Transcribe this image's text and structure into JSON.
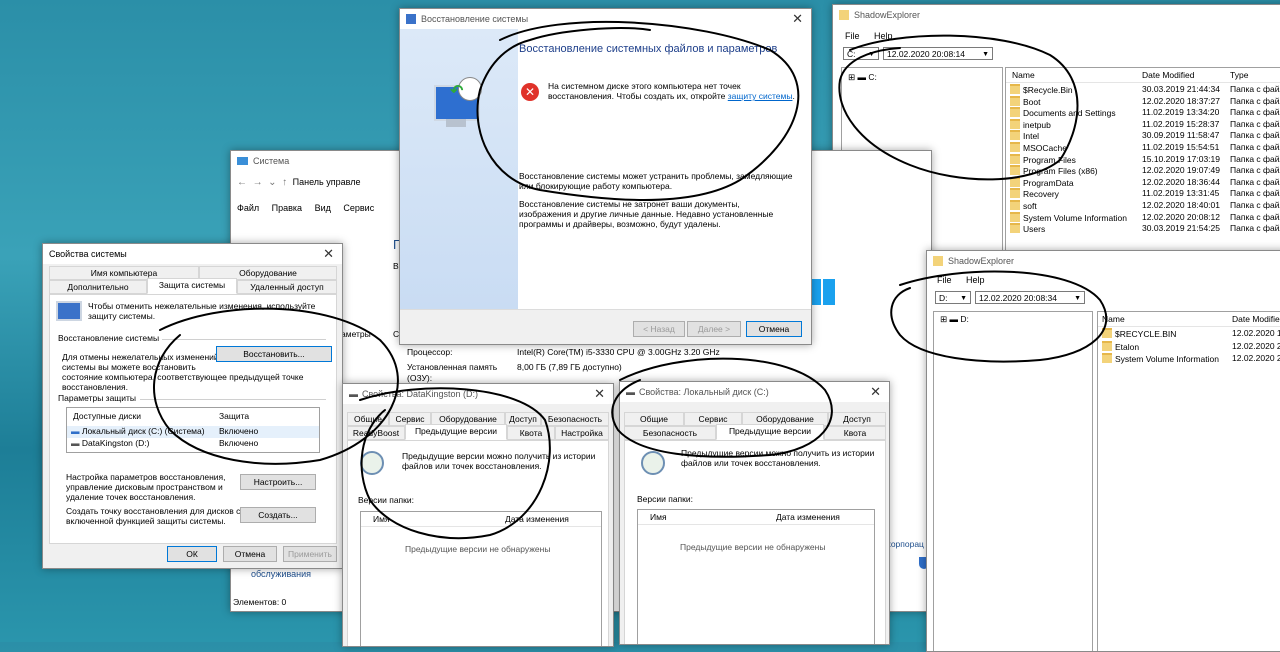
{
  "restore": {
    "title": "Восстановление системы",
    "heading": "Восстановление системных файлов и параметров",
    "error_text_1": "На системном диске этого компьютера нет точек",
    "error_text_2": "восстановления. Чтобы создать их, откройте",
    "error_link": "защиту системы",
    "error_tail": ".",
    "info1_1": "Восстановление системы может устранить проблемы, замедляющие",
    "info1_2": "или блокирующие работу компьютера.",
    "info2_1": "Восстановление системы не затронет ваши документы,",
    "info2_2": "изображения и другие личные данные. Недавно установленные",
    "info2_3": "программы и драйверы, возможно, будут удалены.",
    "back": "< Назад",
    "next": "Далее >",
    "cancel": "Отмена"
  },
  "shadow1": {
    "title": "ShadowExplorer",
    "menu": [
      "File",
      "Help"
    ],
    "drive": "C:",
    "date": "12.02.2020 20:08:14",
    "tree_root": "C:",
    "columns": [
      "Name",
      "Date Modified",
      "Type"
    ],
    "rows": [
      {
        "name": "$Recycle.Bin",
        "date": "30.03.2019 21:44:34",
        "type": "Папка с файл"
      },
      {
        "name": "Boot",
        "date": "12.02.2020 18:37:27",
        "type": "Папка с файл"
      },
      {
        "name": "Documents and Settings",
        "date": "11.02.2019 13:34:20",
        "type": "Папка с файл"
      },
      {
        "name": "inetpub",
        "date": "11.02.2019 15:28:37",
        "type": "Папка с файл"
      },
      {
        "name": "Intel",
        "date": "30.09.2019 11:58:47",
        "type": "Папка с файл"
      },
      {
        "name": "MSOCache",
        "date": "11.02.2019 15:54:51",
        "type": "Папка с файл"
      },
      {
        "name": "Program Files",
        "date": "15.10.2019 17:03:19",
        "type": "Папка с файл"
      },
      {
        "name": "Program Files (x86)",
        "date": "12.02.2020 19:07:49",
        "type": "Папка с файл"
      },
      {
        "name": "ProgramData",
        "date": "12.02.2020 18:36:44",
        "type": "Папка с файл"
      },
      {
        "name": "Recovery",
        "date": "11.02.2019 13:31:45",
        "type": "Папка с файл"
      },
      {
        "name": "soft",
        "date": "12.02.2020 18:40:01",
        "type": "Папка с файл"
      },
      {
        "name": "System Volume Information",
        "date": "12.02.2020 20:08:12",
        "type": "Папка с файл"
      },
      {
        "name": "Users",
        "date": "30.03.2019 21:54:25",
        "type": "Папка с файл"
      }
    ]
  },
  "shadow2": {
    "title": "ShadowExplorer",
    "menu": [
      "File",
      "Help"
    ],
    "drive": "D:",
    "date": "12.02.2020 20:08:34",
    "tree_root": "D:",
    "columns": [
      "Name",
      "Date Modified"
    ],
    "rows": [
      {
        "name": "$RECYCLE.BIN",
        "date": "12.02.2020 1"
      },
      {
        "name": "Etalon",
        "date": "12.02.2020 2"
      },
      {
        "name": "System Volume Information",
        "date": "12.02.2020 2"
      }
    ]
  },
  "system": {
    "title": "Система",
    "address": "Панель управле",
    "menu": [
      "Файл",
      "Правка",
      "Вид",
      "Сервис"
    ],
    "cpu_label": "Процессор:",
    "cpu_value": "Intel(R) Core(TM) i5-3330 CPU @ 3.00GHz   3.20 GHz",
    "ram_label": "Установленная память",
    "ram_label2": "(ОЗУ):",
    "ram_value": "8,00 ГБ (7,89 ГБ доступно)",
    "frag_p": "П",
    "frag_v": "Вы",
    "frag_metry": "аметры",
    "frag_s": "Сі",
    "frag_corp": "корпорац",
    "frag_maint": "обслуживания",
    "status": "Элементов: 0"
  },
  "sysprops": {
    "title": "Свойства системы",
    "tabs_top": [
      "Имя компьютера",
      "Оборудование"
    ],
    "tabs_bottom": [
      "Дополнительно",
      "Защита системы",
      "Удаленный доступ"
    ],
    "intro_1": "Чтобы отменить нежелательные изменения, используйте",
    "intro_2": "защиту системы.",
    "restore_group": "Восстановление системы",
    "restore_text_1": "Для отмены нежелательных изменений",
    "restore_text_2": "системы вы можете восстановить",
    "restore_text_3": "состояние компьютера, соответствующее предыдущей точке",
    "restore_text_4": "восстановления.",
    "restore_btn": "Восстановить...",
    "params_group": "Параметры защиты",
    "col_disks": "Доступные диски",
    "col_protect": "Защита",
    "disks": [
      {
        "name": "Локальный диск (C:) (Система)",
        "state": "Включено"
      },
      {
        "name": "DataKingston (D:)",
        "state": "Включено"
      }
    ],
    "config_text_1": "Настройка параметров восстановления,",
    "config_text_2": "управление дисковым пространством и",
    "config_text_3": "удаление точек восстановления.",
    "config_btn": "Настроить...",
    "create_text_1": "Создать точку восстановления для дисков с",
    "create_text_2": "включенной функцией защиты системы.",
    "create_btn": "Создать...",
    "ok": "ОК",
    "cancel": "Отмена",
    "apply": "Применить"
  },
  "propsD": {
    "title": "Свойства: DataKingston (D:)",
    "tabs_top": [
      "Общие",
      "Сервис",
      "Оборудование",
      "Доступ",
      "Безопасность"
    ],
    "tabs_bottom": [
      "ReadyBoost",
      "Предыдущие версии",
      "Квота",
      "Настройка"
    ],
    "info_1": "Предыдущие версии можно получить из истории",
    "info_2": "файлов или точек восстановления.",
    "versions_label": "Версии папки:",
    "col_name": "Имя",
    "col_date": "Дата изменения",
    "empty": "Предыдущие версии не обнаружены"
  },
  "propsC": {
    "title": "Свойства: Локальный диск (C:)",
    "tabs_top": [
      "Общие",
      "Сервис",
      "Оборудование",
      "Доступ"
    ],
    "tabs_bottom": [
      "Безопасность",
      "Предыдущие версии",
      "Квота"
    ],
    "info_1": "Предыдущие версии можно получить из истории",
    "info_2": "файлов или точек восстановления.",
    "versions_label": "Версии папки:",
    "col_name": "Имя",
    "col_date": "Дата изменения",
    "empty": "Предыдущие версии не обнаружены"
  },
  "colors": {
    "link": "#0066cc",
    "accent": "#0078d7",
    "error": "#e0322a",
    "folder": "#f3d37a",
    "scribble": "#000000"
  }
}
